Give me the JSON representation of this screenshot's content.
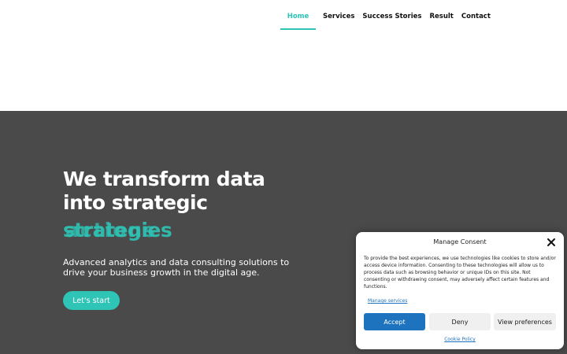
{
  "nav": {
    "items": [
      {
        "label": "Home",
        "active": true
      },
      {
        "label": "Services",
        "active": false
      },
      {
        "label": "Success Stories",
        "active": false
      },
      {
        "label": "Result",
        "active": false
      },
      {
        "label": "Contact",
        "active": false
      }
    ]
  },
  "hero": {
    "title_line1": "We transform data",
    "title_line2": "into strategic",
    "rotating_word_a": "strategies",
    "rotating_word_b": "actions",
    "description": "Advanced analytics and data consulting solutions to drive your business growth in the digital age.",
    "cta_label": "Let's start"
  },
  "consent": {
    "title": "Manage Consent",
    "body": "To provide the best experiences, we use technologies like cookies to store and/or access device information. Consenting to these technologies will allow us to process data such as browsing behavior or unique IDs on this site. Not consenting or withdrawing consent, may adversely affect certain features and functions.",
    "manage_services": "Manage services",
    "accept_label": "Accept",
    "deny_label": "Deny",
    "view_preferences_label": "View preferences",
    "cookie_policy": "Cookie Policy"
  },
  "colors": {
    "accent": "#2ec4b6",
    "hero_bg": "#4a4a4a",
    "button_primary": "#1e73be"
  }
}
